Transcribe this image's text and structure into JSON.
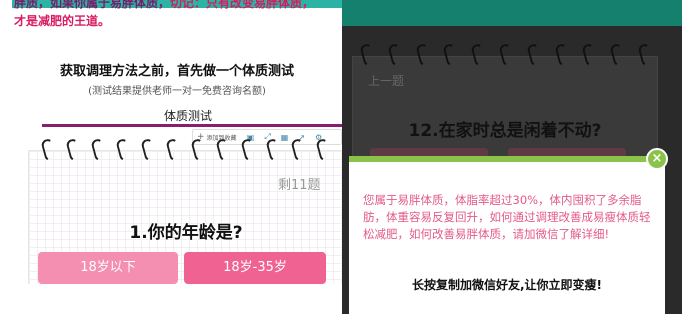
{
  "left": {
    "header_line1_pre": "胖质，",
    "header_line1_mid": "如果你属于易胖体质，",
    "header_line1_em": "切记：只有改变易胖体质，",
    "header_line2": "才是减肥的王道。",
    "title": "获取调理方法之前，首先做一个体质测试",
    "subtitle": "(测试结果提供老师一对一免费咨询名额)",
    "tab_label": "体质测试",
    "toolbar": {
      "add_label": "添加到收藏",
      "icons": [
        "save-icon",
        "expand-icon",
        "grid-icon",
        "share-icon",
        "settings-icon"
      ]
    },
    "remaining": "剩11题",
    "question": "1.你的年龄是?",
    "options": [
      "18岁以下",
      "18岁-35岁"
    ]
  },
  "right": {
    "prev_label": "上一题",
    "question": "12.在家时总是闲着不动?",
    "modal": {
      "result_text": "您属于易胖体质，体脂率超过30%，体内囤积了多余脂肪，体重容易反复回升，如何通过调理改善成易瘦体质轻松减肥，如何改善易胖体质，请加微信了解详细!",
      "footer_text": "长按复制加微信好友,让你立即变瘦!"
    },
    "close_label": "×"
  },
  "colors": {
    "teal_bar": "#2bb3a3",
    "accent_purple": "#8b1d6e",
    "pink_light": "#f48fb1",
    "pink_dark": "#f06292",
    "green": "#8bc34a",
    "modal_text": "#e35a8a"
  }
}
